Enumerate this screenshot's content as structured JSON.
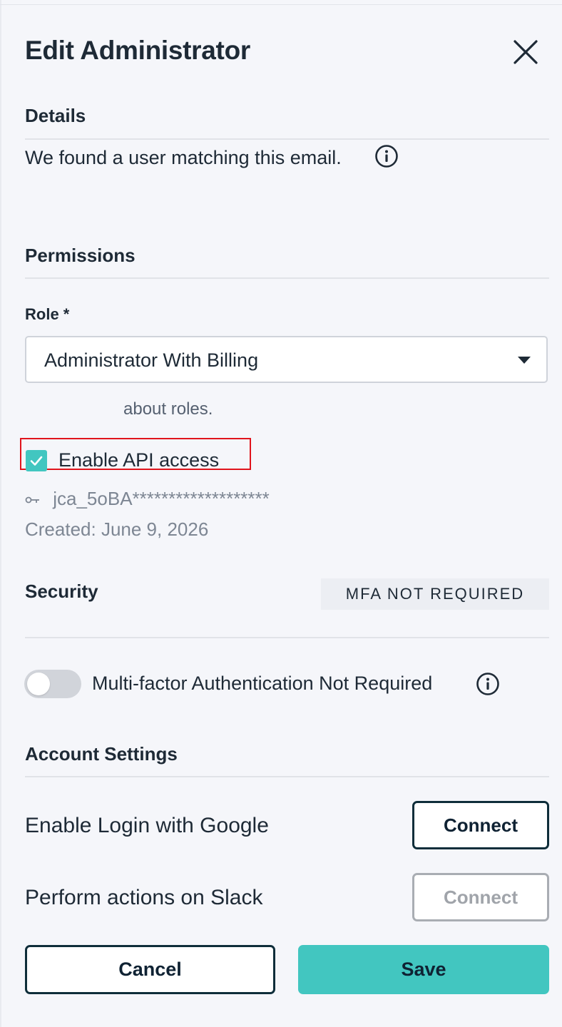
{
  "header": {
    "title": "Edit Administrator",
    "close_icon": "close-icon"
  },
  "details": {
    "heading": "Details",
    "match_text": "We found a user matching this email.",
    "info_icon": "info-icon"
  },
  "permissions": {
    "heading": "Permissions",
    "role_label": "Role *",
    "role_value": "Administrator With Billing",
    "roles_hint": "about roles.",
    "api_access": {
      "label": "Enable API access",
      "checked": true
    },
    "api_key": "jca_5oBA*******************",
    "created": "Created: June 9, 2026"
  },
  "security": {
    "heading": "Security",
    "badge": "MFA NOT REQUIRED",
    "toggle_label": "Multi-factor Authentication Not Required",
    "toggle_on": false
  },
  "account_settings": {
    "heading": "Account Settings",
    "google_label": "Enable Login with Google",
    "google_button": "Connect",
    "slack_label": "Perform actions on Slack",
    "slack_button": "Connect"
  },
  "footer": {
    "cancel_label": "Cancel",
    "save_label": "Save"
  },
  "colors": {
    "accent": "#42c6c0",
    "highlight_border": "#e0141c",
    "dark_border": "#0f2e3a"
  }
}
